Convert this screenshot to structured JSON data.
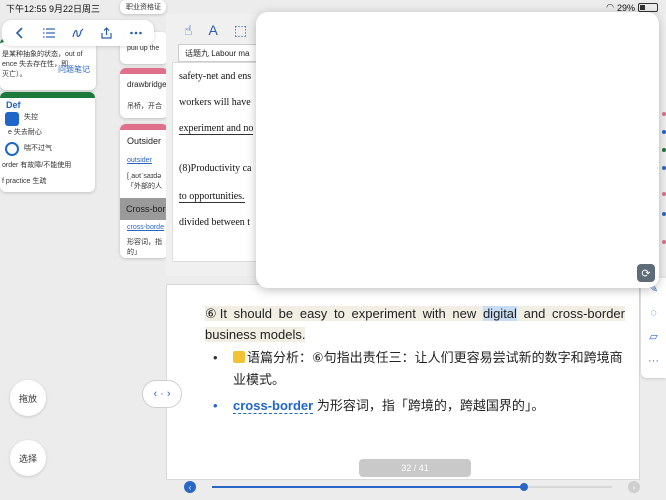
{
  "status": {
    "time": "下午12:55  9月22日周三",
    "battery": "29%"
  },
  "toolbar": {
    "icons": [
      "back-icon",
      "list-icon",
      "scribble-icon",
      "share-icon",
      "more-icon"
    ]
  },
  "cards": {
    "a": {
      "line1": "是某种抽象的状态，out of",
      "line2": "ence 失去存在性，即",
      "line3": "灭亡）。",
      "badge": "问题笔记"
    },
    "def": {
      "title": "Def",
      "rows": [
        "失控",
        "e 失去耐心",
        "喘不过气",
        "order 有故障/不能使用",
        "f practice 生疏"
      ]
    },
    "c": {
      "text": "职业资格证"
    },
    "d": {
      "text": "pull up the"
    },
    "e": {
      "title": "drawbridge",
      "sub": "吊桥，开合"
    },
    "f": {
      "title": "Outsider",
      "link": "outsider",
      "phon": "[ˌaʊtˈsaɪdə",
      "def": "「外部的人",
      "grey_title": "Cross-bor",
      "link2": "cross-borde",
      "def2a": "形容词，指",
      "def2b": "的」"
    }
  },
  "doc": {
    "tab": "话题九 Labour ma",
    "lines": [
      "safety-net and ens",
      "workers will have",
      "experiment and no",
      "(8)Productivity ca",
      "to  opportunities.",
      "divided between t"
    ]
  },
  "content": {
    "sentence_pre": "⑥It should be easy to experiment with new ",
    "sentence_sel": "digital",
    "sentence_post": " and cross-border business models.",
    "bullet1": "语篇分析：⑥句指出责任三：让人们更容易尝试新的数字和跨境商业模式。",
    "bullet2_term": "cross-border",
    "bullet2_text": " 为形容词，指「跨境的，跨越国界的」。",
    "page": "32 / 41"
  },
  "buttons": {
    "drag": "拖放",
    "select": "选择",
    "pan": "‹ · ›"
  },
  "scrubber": {
    "progress": 0.78
  },
  "colors": {
    "accent": "#2a66c7",
    "green": "#1b7a3b",
    "pink": "#e06f8b"
  }
}
